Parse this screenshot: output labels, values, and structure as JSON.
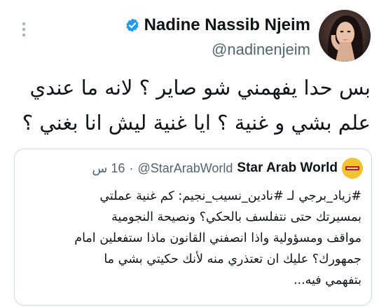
{
  "author": {
    "display_name": "Nadine Nassib Njeim",
    "handle": "@nadinenjeim",
    "verified_color": "#1d9bf0",
    "avatar_icon": "profile-photo-icon"
  },
  "tweet": {
    "text": "بس حدا يفهمني شو صاير ؟ لانه ما عندي\nعلم بشي و غنية ؟ ايا غنية ليش انا بغني ؟"
  },
  "quoted_tweet": {
    "display_name": "Star Arab World",
    "handle": "@StarArabWorld",
    "separator": "·",
    "time": "16 س",
    "text": "#زياد_برجي لـ #نادين_نسيب_نجيم: كم غنية عملتي\nبمسيرتك حتى نتفلسف بالحكي؟ ونصيحة النجومية\nمواقف ومسؤولية واذا انصفني القانون ماذا ستفعلين امام\nجمهورك؟ عليك ان تعتذري منه لأنك حكيتي بشي ما\nبتفهمي فيه..."
  },
  "colors": {
    "text_primary": "#0f1419",
    "text_secondary": "#536471",
    "border": "#cfd9de",
    "quote_avatar_bg": "#f1c232",
    "quote_avatar_text": "#c8102e"
  }
}
